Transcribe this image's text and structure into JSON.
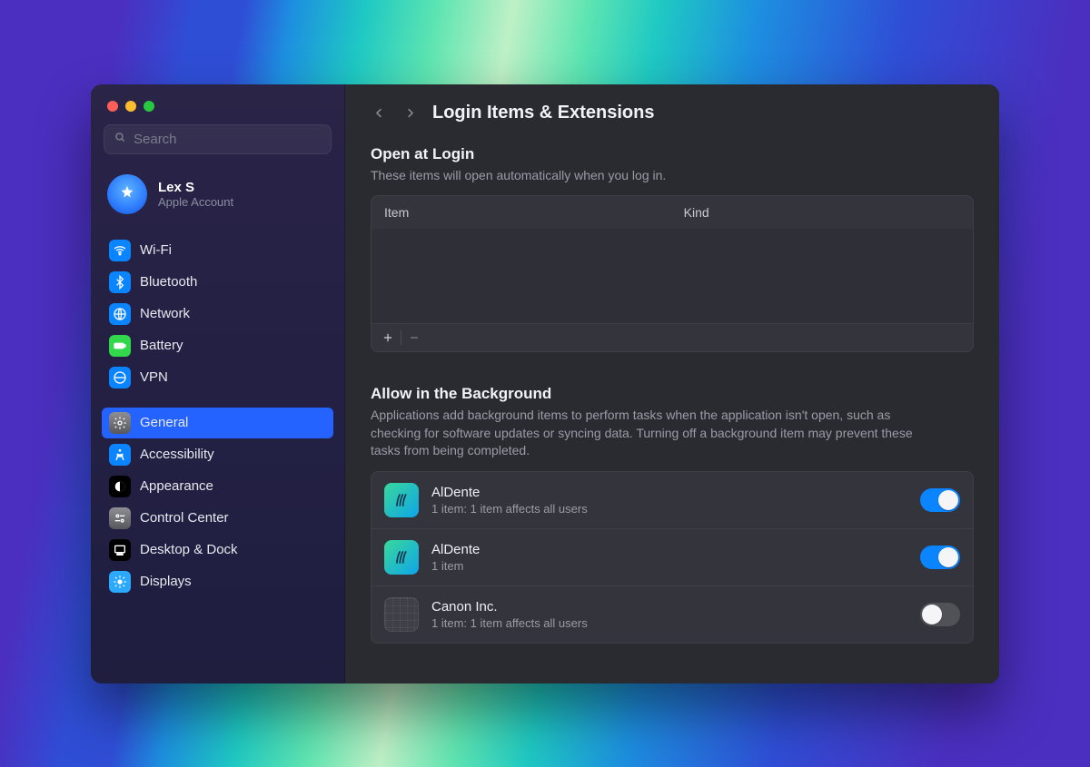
{
  "search": {
    "placeholder": "Search"
  },
  "account": {
    "name": "Lex S",
    "subtitle": "Apple Account"
  },
  "sidebar": {
    "groups": [
      [
        {
          "id": "wifi",
          "label": "Wi-Fi"
        },
        {
          "id": "bluetooth",
          "label": "Bluetooth"
        },
        {
          "id": "network",
          "label": "Network"
        },
        {
          "id": "battery",
          "label": "Battery"
        },
        {
          "id": "vpn",
          "label": "VPN"
        }
      ],
      [
        {
          "id": "general",
          "label": "General",
          "selected": true
        },
        {
          "id": "accessibility",
          "label": "Accessibility"
        },
        {
          "id": "appearance",
          "label": "Appearance"
        },
        {
          "id": "controlcenter",
          "label": "Control Center"
        },
        {
          "id": "desktopdock",
          "label": "Desktop & Dock"
        },
        {
          "id": "displays",
          "label": "Displays"
        }
      ]
    ]
  },
  "page": {
    "title": "Login Items & Extensions",
    "open_at_login": {
      "title": "Open at Login",
      "desc": "These items will open automatically when you log in.",
      "cols": {
        "item": "Item",
        "kind": "Kind"
      },
      "rows": []
    },
    "background": {
      "title": "Allow in the Background",
      "desc": "Applications add background items to perform tasks when the application isn't open, such as checking for software updates or syncing data. Turning off a background item may prevent these tasks from being completed.",
      "items": [
        {
          "name": "AlDente",
          "sub": "1 item: 1 item affects all users",
          "icon": "aldente",
          "on": true
        },
        {
          "name": "AlDente",
          "sub": "1 item",
          "icon": "aldente",
          "on": true
        },
        {
          "name": "Canon Inc.",
          "sub": "1 item: 1 item affects all users",
          "icon": "generic",
          "on": false
        }
      ]
    }
  }
}
